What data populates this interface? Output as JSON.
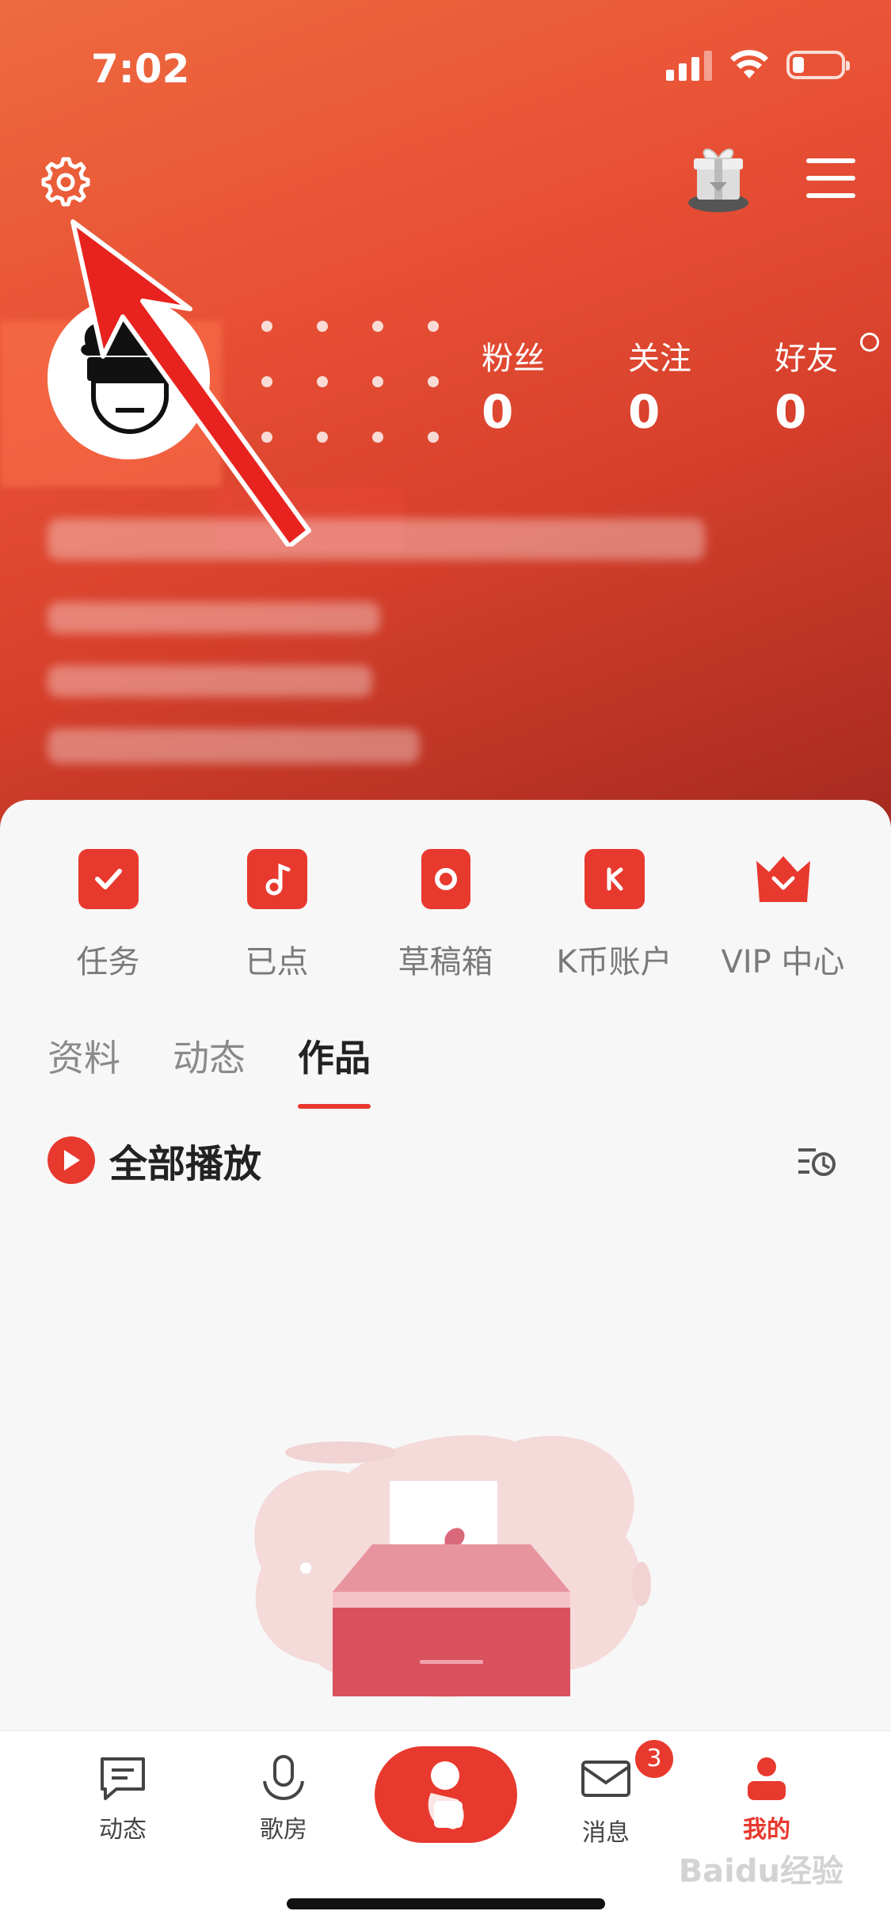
{
  "status_bar": {
    "time": "7:02"
  },
  "profile": {
    "stats": [
      {
        "label": "粉丝",
        "value": "0"
      },
      {
        "label": "关注",
        "value": "0"
      },
      {
        "label": "好友",
        "value": "0"
      }
    ]
  },
  "quick_actions": [
    {
      "label": "任务",
      "icon": "task-check-icon"
    },
    {
      "label": "已点",
      "icon": "music-note-icon"
    },
    {
      "label": "草稿箱",
      "icon": "draft-box-icon"
    },
    {
      "label": "K币账户",
      "icon": "k-coin-wallet-icon"
    },
    {
      "label": "VIP 中心",
      "icon": "vip-crown-icon"
    }
  ],
  "tabs": [
    {
      "label": "资料",
      "active": false
    },
    {
      "label": "动态",
      "active": false
    },
    {
      "label": "作品",
      "active": true
    }
  ],
  "works": {
    "play_all_label": "全部播放"
  },
  "bottom_nav": [
    {
      "label": "动态",
      "icon": "chat-bubble-icon"
    },
    {
      "label": "歌房",
      "icon": "microphone-icon"
    },
    {
      "label": "消息",
      "icon": "mail-icon",
      "badge": "3"
    },
    {
      "label": "我的",
      "icon": "person-icon",
      "active": true
    }
  ],
  "watermark": "Baidu经验",
  "colors": {
    "accent": "#e8392f",
    "header_top": "#ee6a3e",
    "header_bottom": "#a4291f"
  }
}
